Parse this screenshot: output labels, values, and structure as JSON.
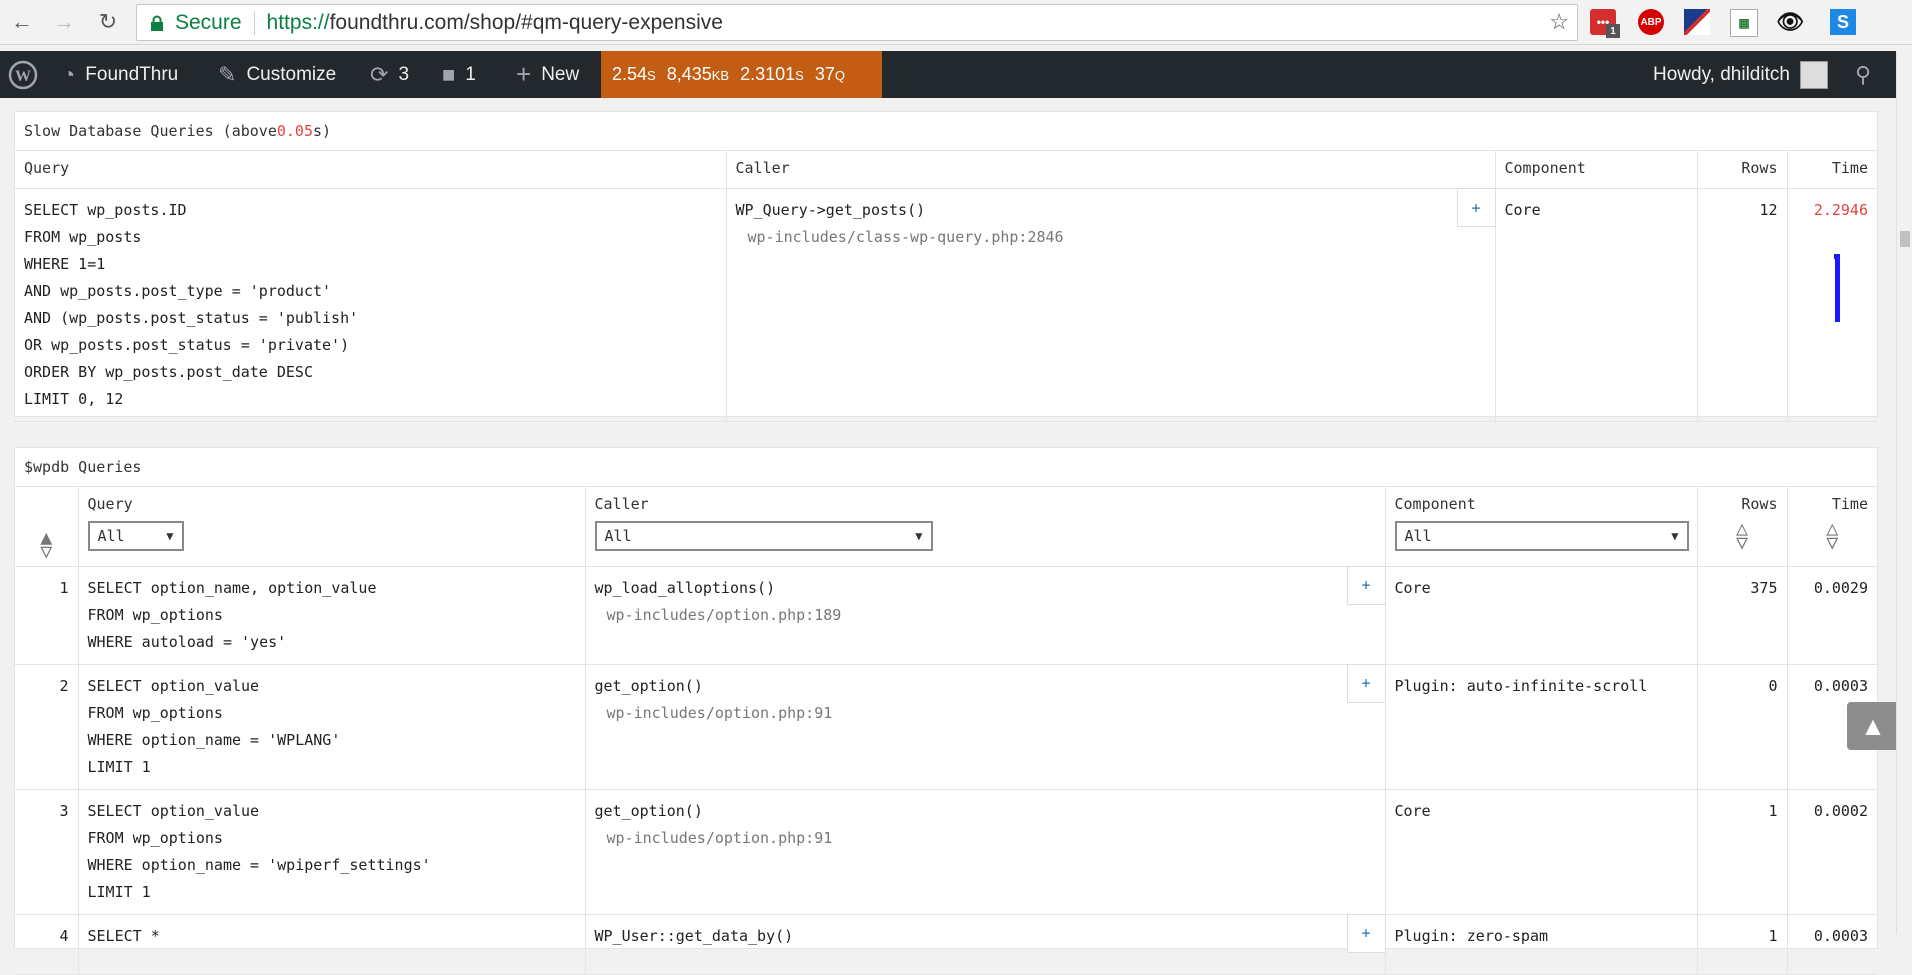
{
  "browser": {
    "back_icon": "arrow-left-icon",
    "forward_icon": "arrow-right-icon",
    "reload_icon": "reload-icon",
    "secure_label": "Secure",
    "url_scheme": "https://",
    "url_rest": "foundthru.com/shop/#qm-query-expensive",
    "ext_badge": "1"
  },
  "adminbar": {
    "site_name": "FoundThru",
    "customize": "Customize",
    "updates_count": "3",
    "comments_count": "1",
    "new_label": "New",
    "qm_time": "2.54",
    "qm_time_unit": "S",
    "qm_memory": "8,435",
    "qm_memory_unit": "KB",
    "qm_query_time": "2.3101",
    "qm_query_time_unit": "S",
    "qm_queries": "37",
    "qm_queries_unit": "Q",
    "howdy": "Howdy, dhilditch"
  },
  "slow_panel": {
    "title_prefix": "Slow Database Queries (above ",
    "threshold": "0.05",
    "title_suffix": "s)",
    "headers": {
      "query": "Query",
      "caller": "Caller",
      "component": "Component",
      "rows": "Rows",
      "time": "Time"
    },
    "row": {
      "query_lines": [
        "SELECT wp_posts.ID",
        "FROM wp_posts",
        "WHERE 1=1",
        "AND wp_posts.post_type = 'product'",
        "AND (wp_posts.post_status = 'publish'",
        "OR wp_posts.post_status = 'private')",
        "ORDER BY wp_posts.post_date DESC",
        "LIMIT 0, 12"
      ],
      "caller": "WP_Query->get_posts()",
      "caller_file": "wp-includes/class-wp-query.php:2846",
      "component": "Core",
      "rows": "12",
      "time": "2.2946",
      "plus": "+"
    }
  },
  "wpdb_panel": {
    "title": "$wpdb Queries",
    "headers": {
      "query": "Query",
      "caller": "Caller",
      "component": "Component",
      "rows": "Rows",
      "time": "Time"
    },
    "filters": {
      "query": "All",
      "caller": "All",
      "component": "All"
    },
    "rows": [
      {
        "n": "1",
        "query_lines": [
          "SELECT option_name, option_value",
          "FROM wp_options",
          "WHERE autoload = 'yes'"
        ],
        "caller": "wp_load_alloptions()",
        "caller_file": "wp-includes/option.php:189",
        "component": "Core",
        "rows": "375",
        "time": "0.0029",
        "plus": "+"
      },
      {
        "n": "2",
        "query_lines": [
          "SELECT option_value",
          "FROM wp_options",
          "WHERE option_name = 'WPLANG'",
          "LIMIT 1"
        ],
        "caller": "get_option()",
        "caller_file": "wp-includes/option.php:91",
        "component": "Plugin: auto-infinite-scroll",
        "rows": "0",
        "time": "0.0003",
        "plus": "+"
      },
      {
        "n": "3",
        "query_lines": [
          "SELECT option_value",
          "FROM wp_options",
          "WHERE option_name = 'wpiperf_settings'",
          "LIMIT 1"
        ],
        "caller": "get_option()",
        "caller_file": "wp-includes/option.php:91",
        "component": "Core",
        "rows": "1",
        "time": "0.0002",
        "plus": ""
      },
      {
        "n": "4",
        "query_lines": [
          "SELECT *"
        ],
        "caller": "WP_User::get_data_by()",
        "caller_file": "",
        "component": "Plugin: zero-spam",
        "rows": "1",
        "time": "0.0003",
        "plus": "+"
      }
    ]
  },
  "colors": {
    "qm_orange": "#c45d14",
    "adminbar_bg": "#23282d",
    "red": "#e4423f",
    "blue_mark": "#1a1aff",
    "secure_green": "#0b8043"
  }
}
